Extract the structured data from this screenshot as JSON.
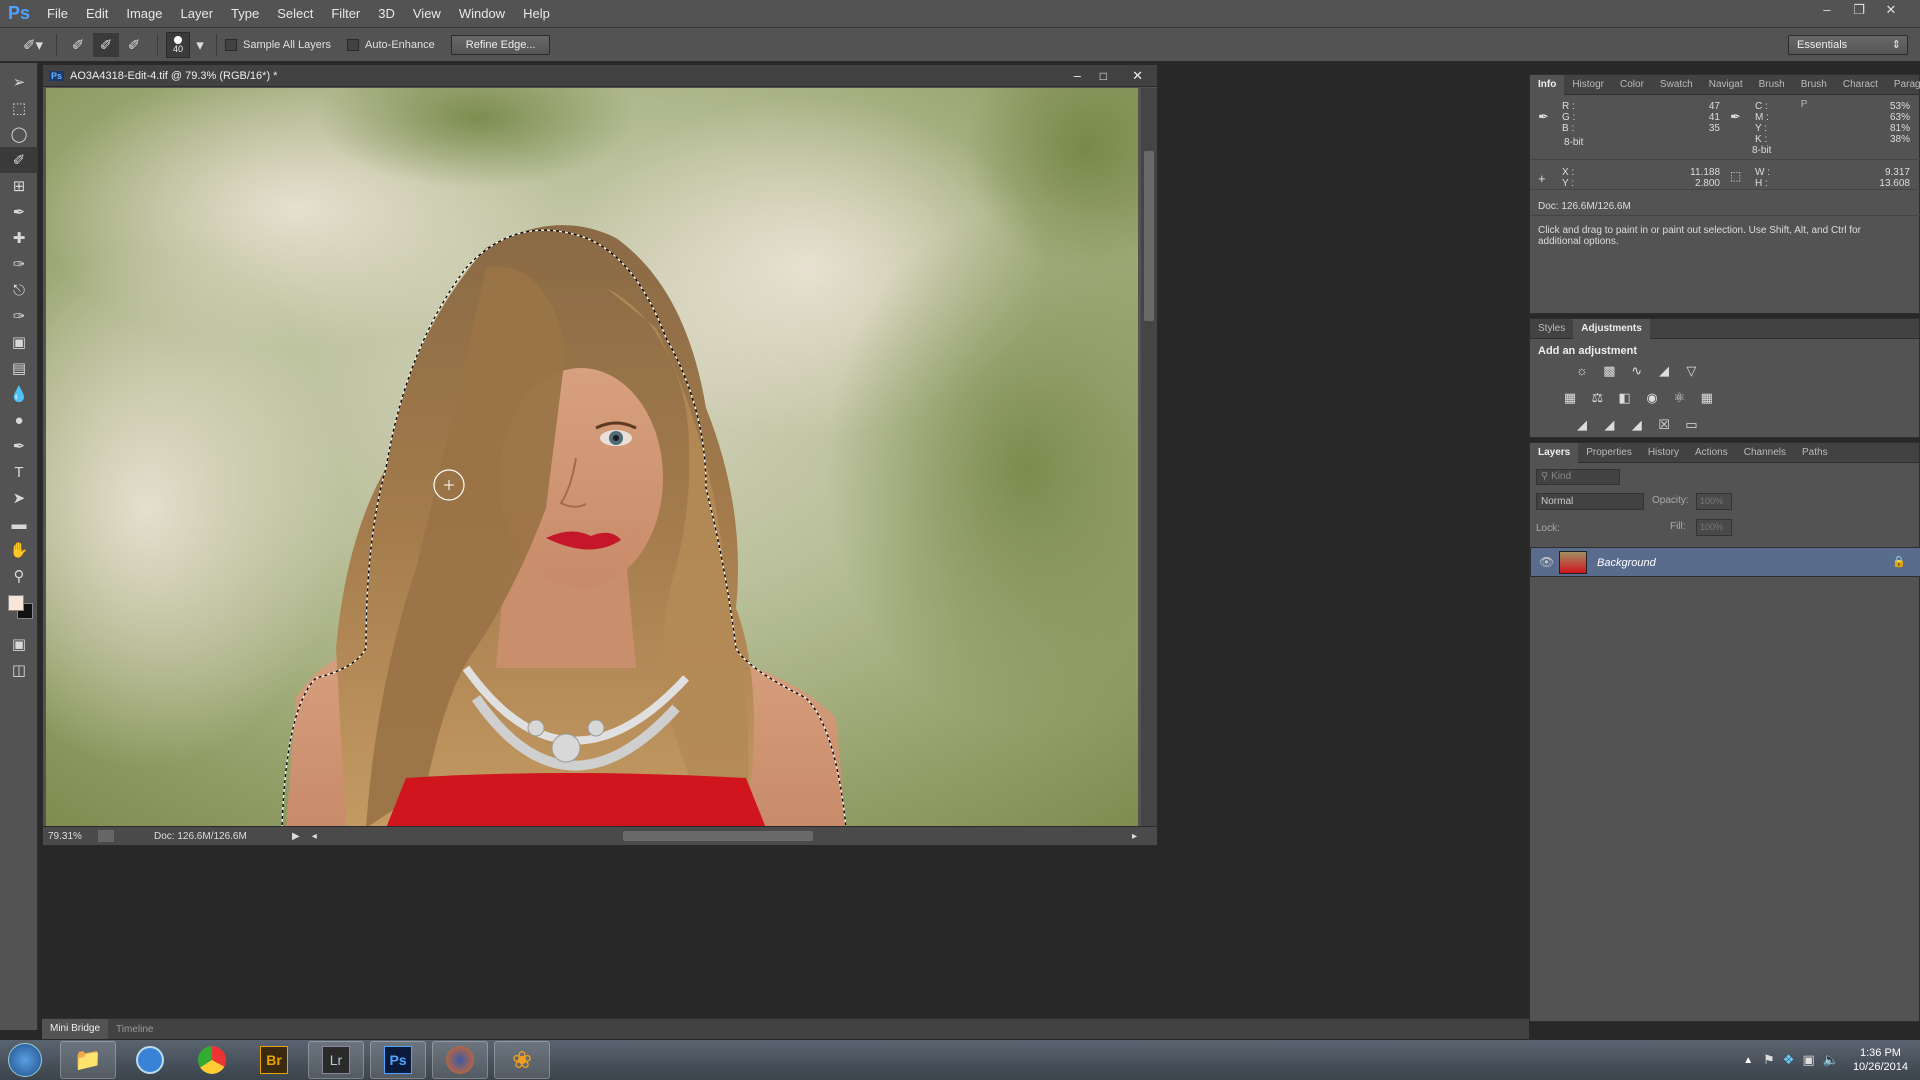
{
  "app": {
    "logo": "Ps"
  },
  "menu": [
    "File",
    "Edit",
    "Image",
    "Layer",
    "Type",
    "Select",
    "Filter",
    "3D",
    "View",
    "Window",
    "Help"
  ],
  "options_bar": {
    "brush_size": "40",
    "sample_all_layers": "Sample All Layers",
    "auto_enhance": "Auto-Enhance",
    "refine_edge": "Refine Edge...",
    "workspace": "Essentials"
  },
  "document": {
    "title": "AO3A4318-Edit-4.tif @ 79.3% (RGB/16*) *",
    "zoom": "79.31%",
    "doc_size": "Doc: 126.6M/126.6M"
  },
  "info_panel": {
    "tabs": [
      "Info",
      "Histogr",
      "Color",
      "Swatch",
      "Navigat",
      "Brush",
      "Brush P",
      "Charact",
      "Paragrap"
    ],
    "rgb": {
      "R": "47",
      "G": "41",
      "B": "35"
    },
    "rgb_depth": "8-bit",
    "cmyk": {
      "C": "53%",
      "M": "63%",
      "Y": "81%",
      "K": "38%"
    },
    "cmyk_depth": "8-bit",
    "xy": {
      "X": "11.188",
      "Y": "2.800"
    },
    "wh": {
      "W": "9.317",
      "H": "13.608"
    },
    "doc": "Doc: 126.6M/126.6M",
    "hint": "Click and drag to paint in or paint out selection.  Use Shift, Alt, and Ctrl for additional options."
  },
  "adjust_panel": {
    "tabs": [
      "Styles",
      "Adjustments"
    ],
    "title": "Add an adjustment"
  },
  "layers_panel": {
    "tabs": [
      "Layers",
      "Properties",
      "History",
      "Actions",
      "Channels",
      "Paths"
    ],
    "kind": "Kind",
    "blend": "Normal",
    "opacity_label": "Opacity:",
    "opacity_value": "100%",
    "lock_label": "Lock:",
    "fill_label": "Fill:",
    "fill_value": "100%",
    "layers": [
      {
        "name": "Background"
      }
    ]
  },
  "bottom_tabs": [
    "Mini Bridge",
    "Timeline"
  ],
  "taskbar": {
    "time": "1:36 PM",
    "date": "10/26/2014",
    "apps": [
      "explorer",
      "itunes",
      "chrome",
      "Br",
      "Lr",
      "Ps",
      "firefox",
      "flower"
    ]
  },
  "colors": {
    "ps_blue": "#4fa3ff",
    "dress_red": "#d0151e",
    "panel_bg": "#535353",
    "selected_layer": "#5a6c8e"
  }
}
